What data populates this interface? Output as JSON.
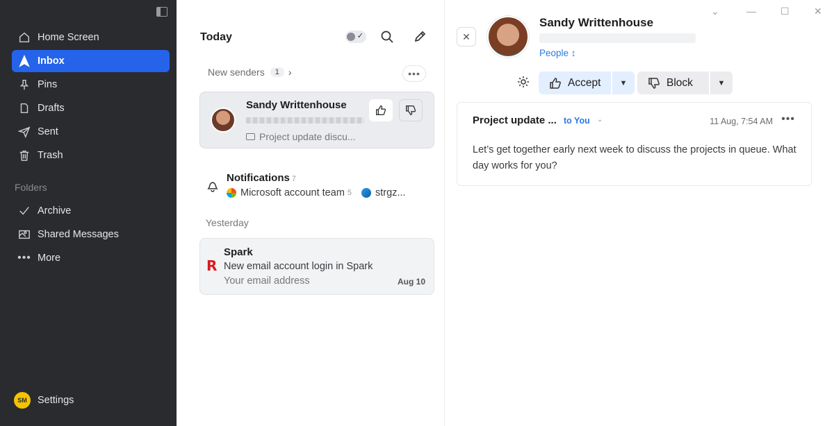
{
  "sidebar": {
    "items": [
      {
        "label": "Home Screen",
        "icon": "home-icon"
      },
      {
        "label": "Inbox",
        "icon": "inbox-icon",
        "active": true
      },
      {
        "label": "Pins",
        "icon": "pin-icon"
      },
      {
        "label": "Drafts",
        "icon": "draft-icon"
      },
      {
        "label": "Sent",
        "icon": "send-icon"
      },
      {
        "label": "Trash",
        "icon": "trash-icon"
      }
    ],
    "folders_label": "Folders",
    "folders": [
      {
        "label": "Archive",
        "icon": "check-icon"
      },
      {
        "label": "Shared Messages",
        "icon": "shared-icon"
      },
      {
        "label": "More",
        "icon": "more-icon"
      }
    ],
    "settings": {
      "initials": "SM",
      "label": "Settings"
    },
    "accent_color": "#2563eb"
  },
  "list": {
    "title": "Today",
    "new_senders": {
      "label": "New senders",
      "count": "1"
    },
    "selected_card": {
      "sender": "Sandy Writtenhouse",
      "subject": "Project update discu..."
    },
    "notifications": {
      "title": "Notifications",
      "count": "7",
      "item1": "Microsoft account team",
      "item1_count": "5",
      "item2": "strgz..."
    },
    "yesterday_label": "Yesterday",
    "spark_card": {
      "sender": "Spark",
      "subject": "New email account login in Spark",
      "preview": "Your email address",
      "date": "Aug 10"
    }
  },
  "detail": {
    "sender_name": "Sandy Writtenhouse",
    "people_label": "People ↕",
    "accept_label": "Accept",
    "block_label": "Block",
    "message": {
      "subject": "Project update ...",
      "to": "to You",
      "time": "11 Aug, 7:54 AM",
      "body": "Let’s get together early next week to discuss the projects in queue. What day works for you?"
    }
  }
}
